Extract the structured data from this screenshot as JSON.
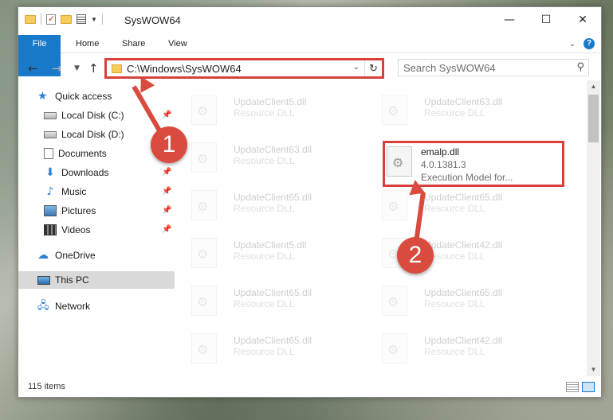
{
  "window": {
    "title": "SysWOW64",
    "controls": {
      "minimize": "—",
      "maximize": "☐",
      "close": "✕"
    }
  },
  "ribbon": {
    "tabs": [
      {
        "label": "File"
      },
      {
        "label": "Home"
      },
      {
        "label": "Share"
      },
      {
        "label": "View"
      }
    ],
    "help": "?"
  },
  "address": {
    "path": "C:\\Windows\\SysWOW64",
    "search_placeholder": "Search SysWOW64"
  },
  "sidebar": {
    "items": [
      {
        "label": "Quick access",
        "icon": "star-icon",
        "pinned": false
      },
      {
        "label": "Local Disk (C:)",
        "icon": "drive-icon",
        "pinned": true
      },
      {
        "label": "Local Disk (D:)",
        "icon": "drive-icon",
        "pinned": false
      },
      {
        "label": "Documents",
        "icon": "documents-icon",
        "pinned": true
      },
      {
        "label": "Downloads",
        "icon": "downloads-icon",
        "pinned": true
      },
      {
        "label": "Music",
        "icon": "music-icon",
        "pinned": true
      },
      {
        "label": "Pictures",
        "icon": "pictures-icon",
        "pinned": true
      },
      {
        "label": "Videos",
        "icon": "videos-icon",
        "pinned": true
      },
      {
        "label": "OneDrive",
        "icon": "onedrive-icon",
        "pinned": false
      },
      {
        "label": "This PC",
        "icon": "this-pc-icon",
        "pinned": false,
        "selected": true
      },
      {
        "label": "Network",
        "icon": "network-icon",
        "pinned": false
      }
    ]
  },
  "files": {
    "left": [
      {
        "name": "UpdateClient5.dll",
        "desc": "Resource DLL"
      },
      {
        "name": "UpdateClient63.dll",
        "desc": "Resource DLL"
      },
      {
        "name": "UpdateClient65.dll",
        "desc": "Resource DLL"
      },
      {
        "name": "UpdateClient5.dll",
        "desc": "Resource DLL"
      },
      {
        "name": "UpdateClient65.dll",
        "desc": "Resource DLL"
      },
      {
        "name": "UpdateClient65.dll",
        "desc": "Resource DLL"
      }
    ],
    "right": [
      {
        "name": "UpdateClient63.dll",
        "desc": "Resource DLL"
      },
      {
        "name": "UpdateClient65.dll",
        "desc": "Resource DLL"
      },
      {
        "name": "UpdateClient42.dll",
        "desc": "Resource DLL"
      },
      {
        "name": "UpdateClient65.dll",
        "desc": "Resource DLL"
      },
      {
        "name": "UpdateClient42.dll",
        "desc": "Resource DLL"
      }
    ],
    "highlighted": {
      "name": "emalp.dll",
      "version": "4.0.1381.3",
      "desc": "Execution Model for..."
    }
  },
  "status": {
    "items": "115 items"
  },
  "annotations": {
    "step1": "1",
    "step2": "2",
    "color": "#d94b3f"
  }
}
